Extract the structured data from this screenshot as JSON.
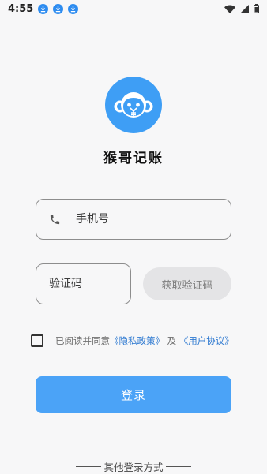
{
  "status_bar": {
    "time": "4:55",
    "download_icons": [
      "download-icon",
      "download-icon",
      "download-icon"
    ],
    "right_icons": [
      "wifi-icon",
      "signal-icon",
      "battery-icon"
    ]
  },
  "app": {
    "logo_icon": "monkey-yen-logo",
    "name": "猴哥记账",
    "accent_color": "#3e9ef5"
  },
  "form": {
    "phone_placeholder": "手机号",
    "code_placeholder": "验证码",
    "get_code_label": "获取验证码",
    "agree_prefix": "已阅读并同意",
    "privacy_link": "《隐私政策》",
    "and_text": "及",
    "user_agreement_link": "《用户协议》",
    "login_label": "登录"
  },
  "footer": {
    "other_login_label": "其他登录方式"
  }
}
